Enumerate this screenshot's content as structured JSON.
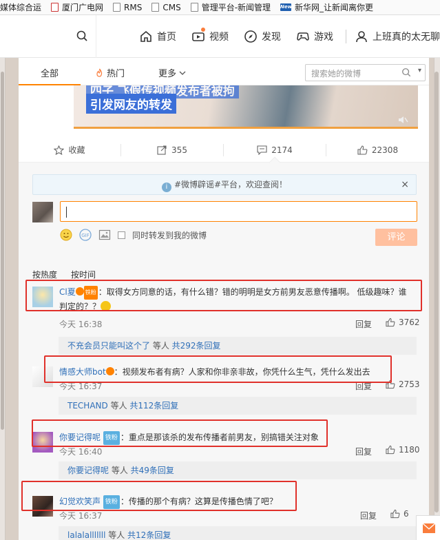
{
  "bookmarks": [
    {
      "label": "媒体综合运",
      "icon": "page-icon"
    },
    {
      "label": "厦门广电网",
      "icon": "red-page-icon"
    },
    {
      "label": "RMS",
      "icon": "page-icon"
    },
    {
      "label": "CMS",
      "icon": "page-icon"
    },
    {
      "label": "管理平台-新闻管理",
      "icon": "page-icon"
    },
    {
      "label": "新华网_让新闻离你更",
      "icon": "news-icon"
    }
  ],
  "news_logo_text": "News",
  "topnav": {
    "home": "首页",
    "video": "视频",
    "discover": "发现",
    "games": "游戏",
    "user": "上班真的太无聊"
  },
  "tabs": {
    "all": "全部",
    "hot": "热门",
    "more": "更多"
  },
  "weibo_search": {
    "placeholder": "搜索她的微博"
  },
  "media": {
    "caption_line1": "四子 飞假传视频发布者被拘 ",
    "caption_line2": "引发网友的转发"
  },
  "actions": {
    "favorite": "收藏",
    "repost_count": "355",
    "comment_count": "2174",
    "like_count": "22308"
  },
  "notice": {
    "text": "#微博辟谣#平台，欢迎查阅！",
    "close": "×"
  },
  "composer": {
    "forward_label": "同时转发到我的微博",
    "submit": "评论"
  },
  "sort": {
    "by_hot": "按热度",
    "by_time": "按时间"
  },
  "comments": [
    {
      "user": "Cl夏",
      "badge": "铁粉",
      "text": "：取得女方同意的话，有什么错？错的明明是女方前男友恶意传播啊。 低级趣味？谁",
      "text2": "判定的？？",
      "time": "今天 16:38",
      "reply": "回复",
      "likes": "3762",
      "sub_users": "不充会员只能叫这个了",
      "sub_mid": " 等人 ",
      "sub_count": "共292条回复"
    },
    {
      "user": "情感大师bot",
      "badge": "",
      "text": "：视频发布者有病？人家和你非亲非故，你凭什么生气，凭什么发出去",
      "time": "今天 16:37",
      "reply": "回复",
      "likes": "2753",
      "sub_users": "TECHAND",
      "sub_mid": " 等人 ",
      "sub_count": "共112条回复"
    },
    {
      "user": "你要记得呢",
      "badge": "铁粉",
      "text": "：重点是那该杀的发布传播者前男友，别搞错关注对象",
      "time": "今天 16:40",
      "reply": "回复",
      "likes": "1180",
      "sub_users": "你要记得呢",
      "sub_mid": " 等人 ",
      "sub_count": "共49条回复"
    },
    {
      "user": "幻觉欢笑声",
      "badge": "铁粉",
      "text": "：传播的那个有病？这算是传播色情了吧？",
      "time": "今天 16:37",
      "reply": "回复",
      "likes": "6",
      "sub_users": "lalalalllllll",
      "sub_mid": " 等人 ",
      "sub_count": "共12条回复"
    }
  ],
  "colors": {
    "accent": "#ff8200",
    "username": "#eb7350",
    "highlight_box": "#e0302a"
  }
}
